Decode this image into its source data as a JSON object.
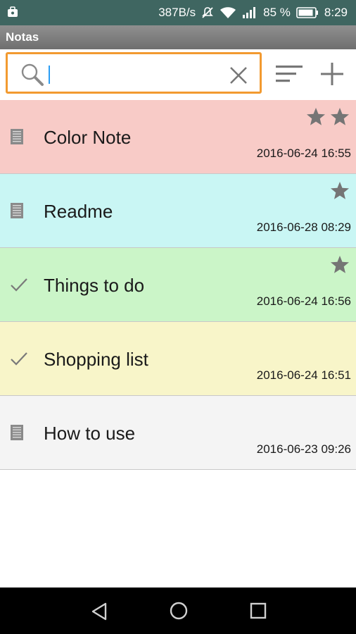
{
  "status_bar": {
    "net_speed": "387B/s",
    "battery_percent": "85 %",
    "time": "8:29",
    "icons": [
      "bag-icon",
      "mute-icon",
      "wifi-icon",
      "signal-icon",
      "battery-icon"
    ]
  },
  "title_bar": {
    "title": "Notas"
  },
  "search": {
    "value": "",
    "placeholder": ""
  },
  "toolbar": {
    "icons": [
      "search-icon",
      "clear-icon",
      "sort-icon",
      "add-icon"
    ]
  },
  "notes": [
    {
      "title": "Color Note",
      "date": "2016-06-24 16:55",
      "stars": 2,
      "kind": "text",
      "color": "#f8cbc7"
    },
    {
      "title": "Readme",
      "date": "2016-06-28 08:29",
      "stars": 1,
      "kind": "text",
      "color": "#c9f6f4"
    },
    {
      "title": "Things to do",
      "date": "2016-06-24 16:56",
      "stars": 1,
      "kind": "checklist",
      "color": "#cbf5c8"
    },
    {
      "title": "Shopping list",
      "date": "2016-06-24 16:51",
      "stars": 0,
      "kind": "checklist",
      "color": "#f8f5c9"
    },
    {
      "title": "How to use",
      "date": "2016-06-23 09:26",
      "stars": 0,
      "kind": "text",
      "color": "#f4f4f4"
    }
  ],
  "nav_bar": {
    "icons": [
      "back-icon",
      "home-icon",
      "recent-apps-icon"
    ]
  }
}
